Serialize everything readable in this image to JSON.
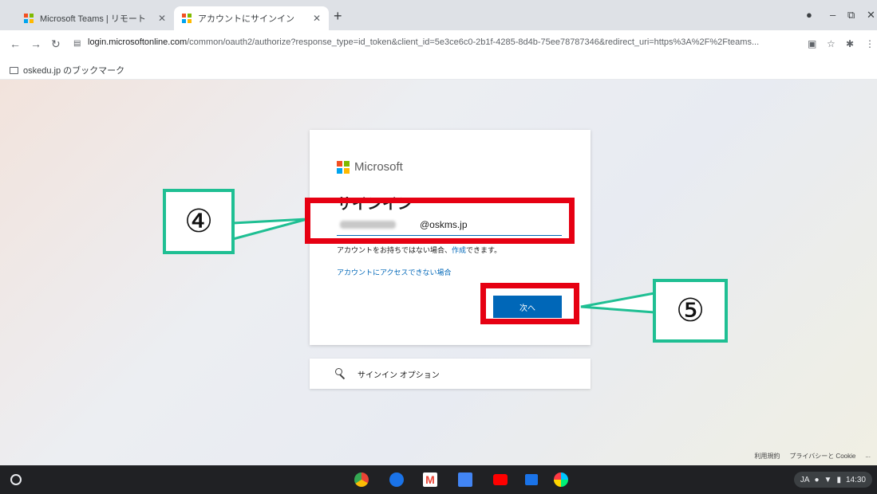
{
  "browser": {
    "tabs": [
      {
        "title": "Microsoft Teams | リモート ",
        "active": false
      },
      {
        "title": "アカウントにサインイン",
        "active": true
      }
    ],
    "new_tab": "+",
    "url_host": "login.microsoftonline.com",
    "url_path": "/common/oauth2/authorize?response_type=id_token&client_id=5e3ce6c0-2b1f-4285-8d4b-75ee78787346&redirect_uri=https%3A%2F%2Fteams...",
    "bookmark": "oskedu.jp のブックマーク"
  },
  "signin": {
    "brand": "Microsoft",
    "title": "サインイン",
    "email_value": "@oskms.jp",
    "no_account_text": "アカウントをお持ちではない場合、",
    "create_link": "作成",
    "no_account_suffix": "できます。",
    "cant_access": "アカウントにアクセスできない場合",
    "next_label": "次へ",
    "options_label": "サインイン オプション"
  },
  "footer": {
    "terms": "利用規約",
    "privacy": "プライバシーと Cookie",
    "more": "..."
  },
  "annotations": {
    "step4": "④",
    "step5": "⑤",
    "box_color": "#e60012",
    "callout_color": "#1fbf93"
  },
  "shelf": {
    "input_method": "JA",
    "time": "14:30"
  },
  "colors": {
    "accent": "#0067b8",
    "ms_red": "#f25022",
    "ms_green": "#7fba00",
    "ms_blue": "#00a4ef",
    "ms_yellow": "#ffb900"
  }
}
